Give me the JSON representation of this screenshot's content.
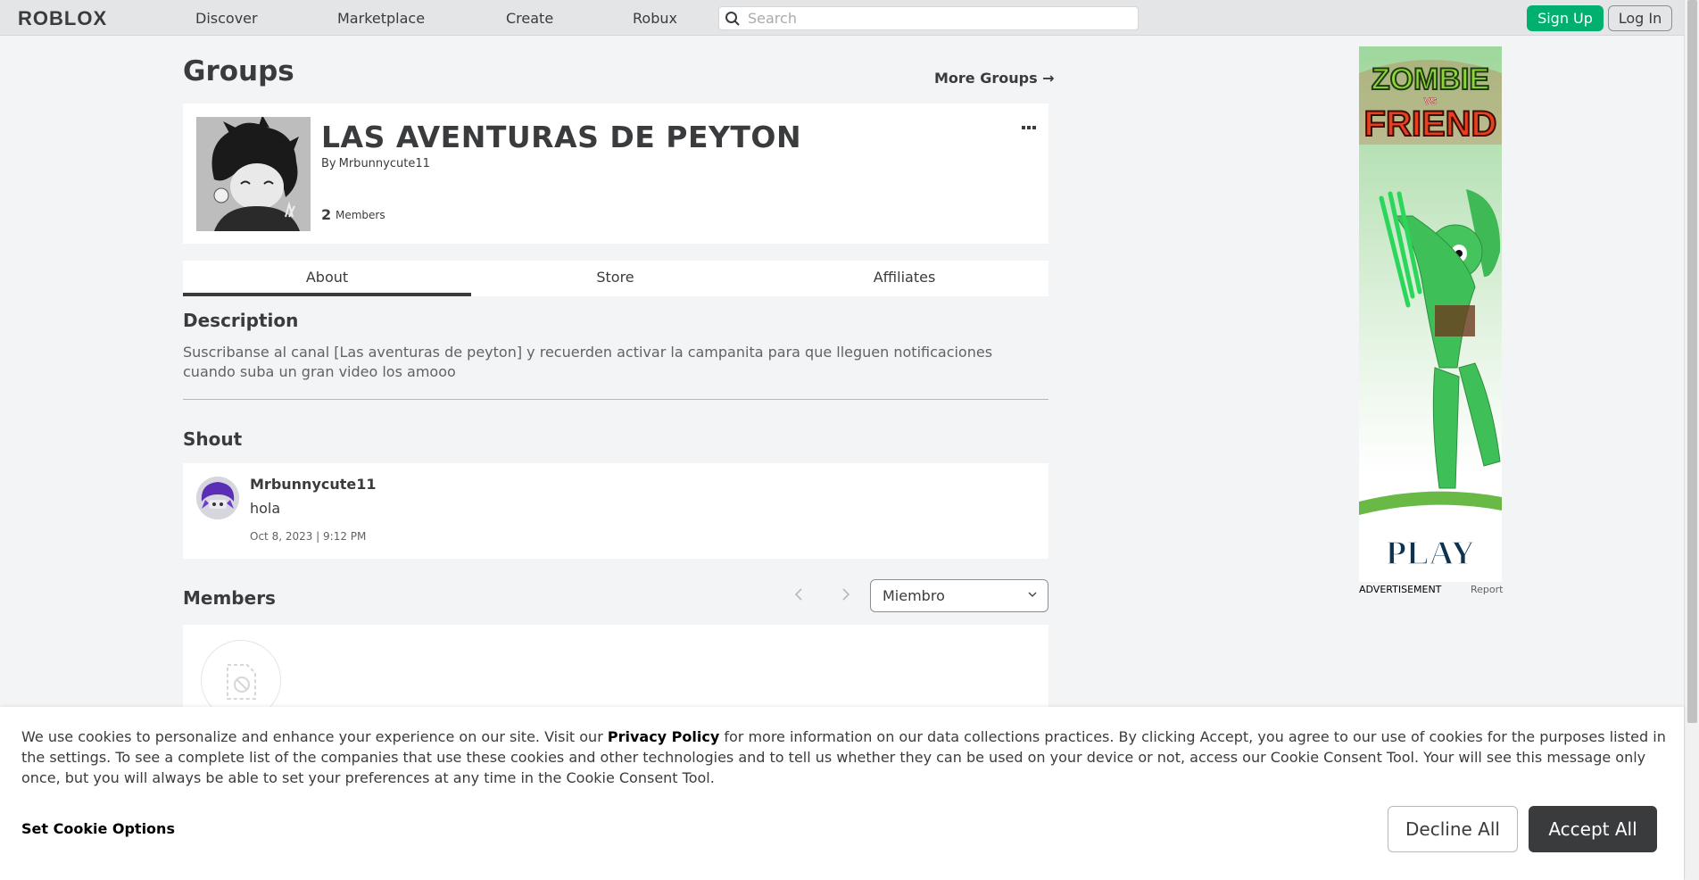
{
  "nav": {
    "logo": "ROBLOX",
    "links": [
      "Discover",
      "Marketplace",
      "Create",
      "Robux"
    ],
    "search_placeholder": "Search",
    "signup_label": "Sign Up",
    "login_label": "Log In"
  },
  "page": {
    "title": "Groups",
    "more_groups": "More Groups →"
  },
  "group": {
    "name": "LAS AVENTURAS DE PEYTON",
    "by_prefix": "By",
    "owner": "Mrbunnycute11",
    "member_count": "2",
    "member_label": "Members"
  },
  "tabs": [
    "About",
    "Store",
    "Affiliates"
  ],
  "about": {
    "description_heading": "Description",
    "description": "Suscribanse al canal [Las aventuras de peyton] y recuerden activar la campanita para que lleguen notificaciones cuando suba un gran video los amooo",
    "shout_heading": "Shout",
    "shout": {
      "user": "Mrbunnycute11",
      "text": "hola",
      "time": "Oct 8, 2023 | 9:12 PM"
    },
    "members_heading": "Members",
    "role_select": "Miembro"
  },
  "ad": {
    "title_top": "ZOMBIE",
    "title_vs": "VS",
    "title_bottom": "FRIEND",
    "play": "PLAY",
    "label": "ADVERTISEMENT",
    "report": "Report"
  },
  "cookie": {
    "text_before": "We use cookies to personalize and enhance your experience on our site. Visit our ",
    "policy_link": "Privacy Policy",
    "text_after": " for more information on our data collections practices. By clicking Accept, you agree to our use of cookies for the purposes listed in the settings. To see a complete list of the companies that use these cookies and other technologies and to tell us whether they can be used on your device or not, access our Cookie Consent Tool. Your will see this message only once, but you will always be able to set your preferences at any time in the Cookie Consent Tool.",
    "options_label": "Set Cookie Options",
    "decline_label": "Decline All",
    "accept_label": "Accept All"
  },
  "colors": {
    "signup_green": "#00b06f",
    "text_dark": "#393b3d",
    "page_bg": "#f2f4f5"
  }
}
